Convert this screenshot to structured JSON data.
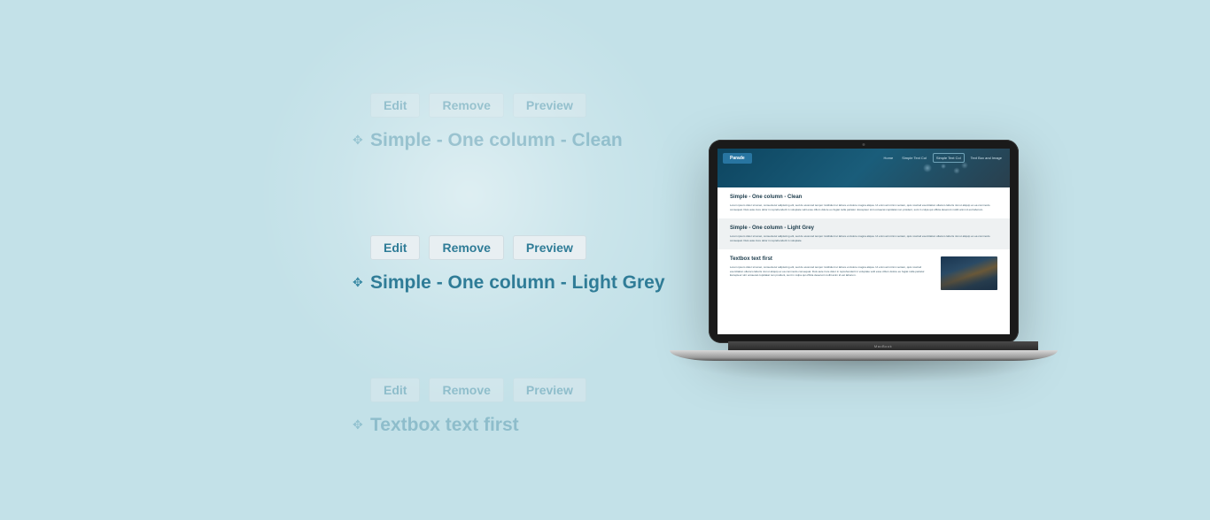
{
  "blocks": [
    {
      "buttons": {
        "edit": "Edit",
        "remove": "Remove",
        "preview": "Preview"
      },
      "title": "Simple - One column - Clean",
      "faded": true
    },
    {
      "buttons": {
        "edit": "Edit",
        "remove": "Remove",
        "preview": "Preview"
      },
      "title": "Simple - One column - Light Grey",
      "faded": false
    },
    {
      "buttons": {
        "edit": "Edit",
        "remove": "Remove",
        "preview": "Preview"
      },
      "title": "Textbox text first",
      "faded": true
    }
  ],
  "laptop": {
    "brand_label": "Parade",
    "device_label": "MacBook",
    "nav": [
      {
        "label": "Home",
        "boxed": false
      },
      {
        "label": "Simple Text Col",
        "boxed": false
      },
      {
        "label": "Simple Text Col",
        "boxed": true
      },
      {
        "label": "Text Box and Image",
        "boxed": false
      }
    ],
    "sections": [
      {
        "title": "Simple - One column - Clean",
        "body": "Lorem ipsum dolor sit amet, consectetur adipiscing elit, sed do eiusmod tempor incididunt ut labore et dolore magna aliqua. Ut enim ad minim veniam, quis nostrud exercitation ullamco laboris nisi ut aliquip ex ea commodo consequat. Duis aute irure dolor in reprehenderit in voluptate velit esse cillum dolore eu fugiat nulla pariatur. Excepteur sint occaecat cupidatat non proident, sunt in culpa qui officia deserunt mollit anim id est laborum."
      },
      {
        "title": "Simple - One column - Light Grey",
        "body": "Lorem ipsum dolor sit amet, consectetur adipiscing elit, sed do eiusmod tempor incididunt ut labore et dolore magna aliqua. Ut enim ad minim veniam, quis nostrud exercitation ullamco laboris nisi ut aliquip ex ea commodo consequat. Duis aute irure dolor in reprehenderit in voluptate."
      },
      {
        "title": "Textbox text first",
        "body": "Lorem ipsum dolor sit amet, consectetur adipiscing elit, sed do eiusmod tempor incididunt ut labore et dolore magna aliqua. Ut enim ad minim veniam, quis nostrud exercitation ullamco laboris nisi ut aliquip ex ea commodo consequat. Duis aute irure dolor in reprehenderit in voluptate velit esse cillum dolore eu fugiat nulla pariatur. Excepteur sint occaecat cupidatat non proident, sunt in culpa qui officia deserunt mollit anim id est laborum."
      }
    ]
  }
}
